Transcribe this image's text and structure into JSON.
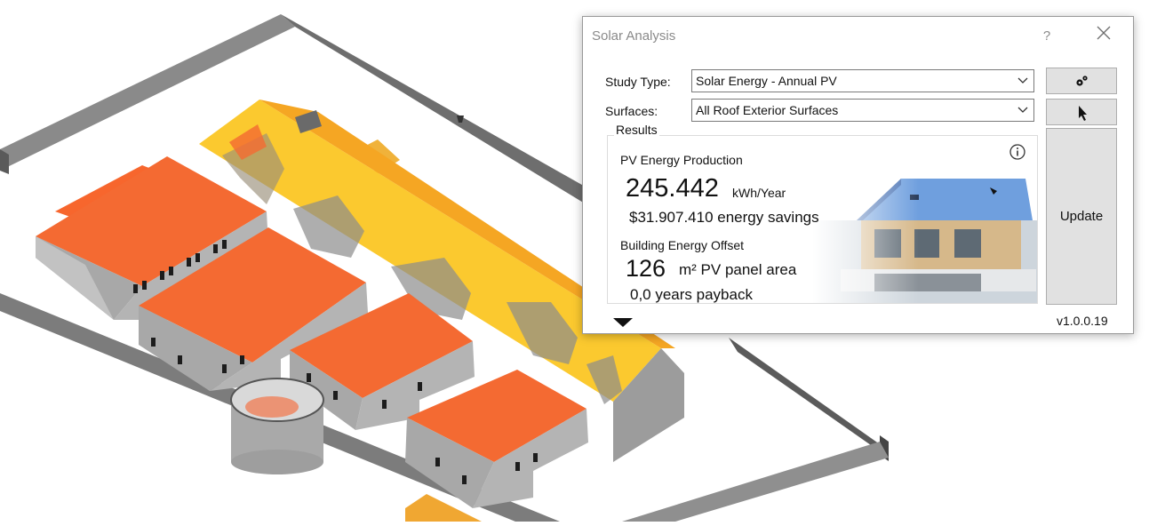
{
  "dialog": {
    "title": "Solar Analysis",
    "help_label": "?",
    "study_type_label": "Study Type:",
    "study_type_value": "Solar Energy - Annual PV",
    "surfaces_label": "Surfaces:",
    "surfaces_value": "All Roof Exterior Surfaces",
    "results_label": "Results",
    "pv_section_title": "PV Energy Production",
    "energy_value": "245.442",
    "energy_unit": "kWh/Year",
    "savings_text": "$31.907.410 energy savings",
    "offset_section_title": "Building Energy Offset",
    "area_value": "126",
    "area_unit": "m² PV panel area",
    "payback_text": "0,0 years payback",
    "update_label": "Update",
    "version": "v1.0.0.19",
    "info_icon": "info-icon",
    "settings_icon": "gears-icon",
    "pick_icon": "cursor-icon"
  },
  "colors": {
    "roof_orange": "#f46a32",
    "roof_yellow": "#fbc92f",
    "wall_gray": "#b4b4b4",
    "sky_blue": "#6f9fde",
    "button_gray": "#e1e1e1"
  }
}
